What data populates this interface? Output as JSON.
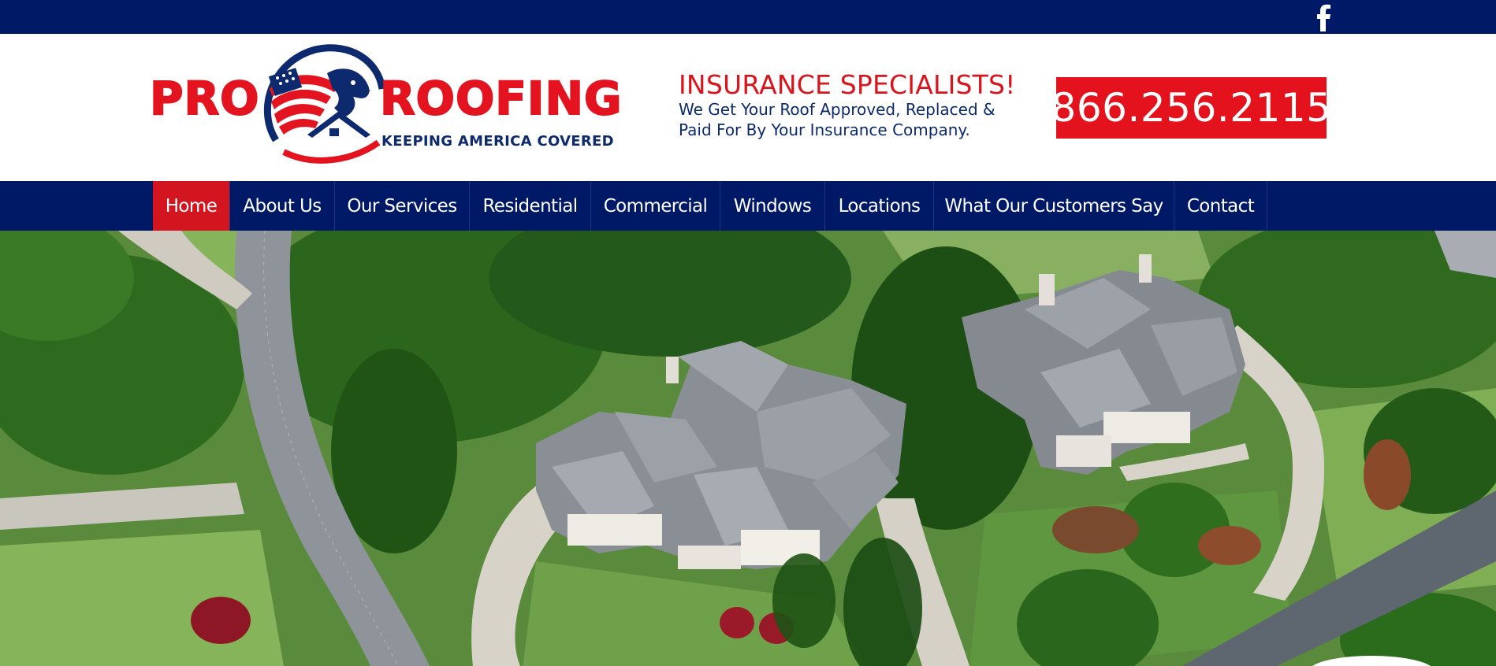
{
  "topbar": {
    "social_icon": "facebook-icon",
    "background_color": "#001966"
  },
  "header": {
    "logo": {
      "word_pro": "PRO",
      "word_roofing": "ROOFING",
      "tagline": "KEEPING AMERICA COVERED",
      "colors": {
        "red": "#e3141f",
        "navy": "#0d2a6e"
      }
    },
    "insurance": {
      "title": "INSURANCE SPECIALISTS!",
      "line1": "We Get Your Roof Approved, Replaced &",
      "line2": "Paid For By Your Insurance Company."
    },
    "phone": "866.256.2115",
    "phone_bg_color": "#e3121c"
  },
  "nav": {
    "background_color": "#001966",
    "active_color": "#d31520",
    "items": [
      {
        "label": "Home",
        "active": true
      },
      {
        "label": "About Us",
        "active": false
      },
      {
        "label": "Our Services",
        "active": false
      },
      {
        "label": "Residential",
        "active": false
      },
      {
        "label": "Commercial",
        "active": false
      },
      {
        "label": "Windows",
        "active": false
      },
      {
        "label": "Locations",
        "active": false
      },
      {
        "label": "What Our Customers Say",
        "active": false
      },
      {
        "label": "Contact",
        "active": false
      }
    ]
  },
  "hero": {
    "image": "aerial-neighborhood-houses-photo"
  }
}
